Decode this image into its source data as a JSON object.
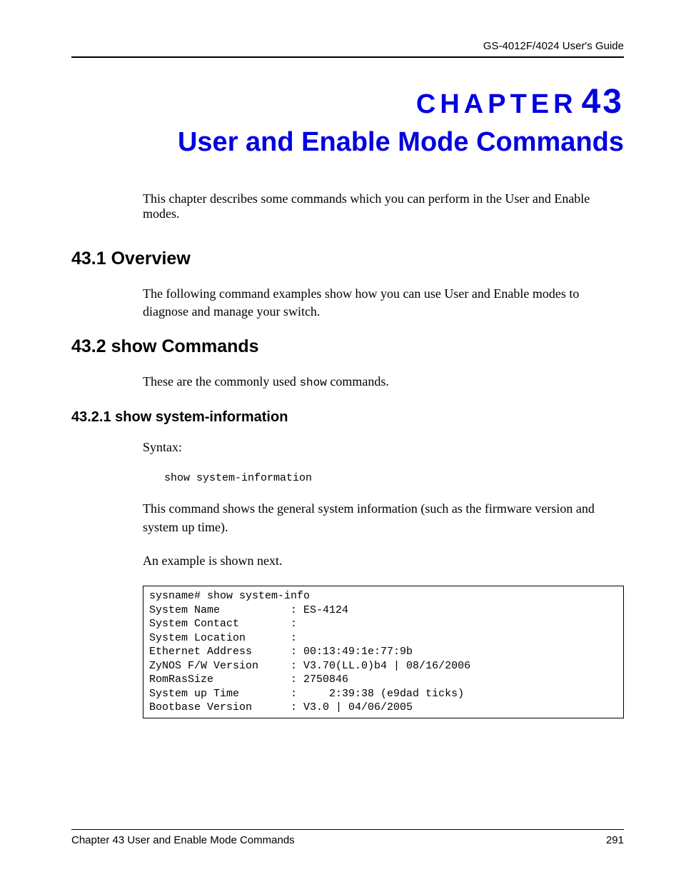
{
  "header": {
    "guide_title": "GS-4012F/4024 User's Guide"
  },
  "chapter": {
    "label_word": "CHAPTER",
    "label_num": "43",
    "title": "User and Enable Mode Commands"
  },
  "intro_text": "This chapter describes some commands which you can perform in the User and Enable modes.",
  "sections": {
    "s1": {
      "heading": "43.1  Overview",
      "body": "The following command examples show how you can use User and Enable modes to diagnose and manage your switch."
    },
    "s2": {
      "heading": "43.2  show Commands",
      "body_pre": "These are the commonly used ",
      "body_mono": "show",
      "body_post": " commands.",
      "sub1": {
        "heading": "43.2.1  show system-information",
        "syntax_label": "Syntax:",
        "syntax_cmd": "show system-information",
        "desc": "This command shows the general system information (such as the firmware version and system up time).",
        "example_intro": "An example is shown next.",
        "code": "sysname# show system-info\nSystem Name           : ES-4124\nSystem Contact        :\nSystem Location       :\nEthernet Address      : 00:13:49:1e:77:9b\nZyNOS F/W Version     : V3.70(LL.0)b4 | 08/16/2006\nRomRasSize            : 2750846\nSystem up Time        :     2:39:38 (e9dad ticks)\nBootbase Version      : V3.0 | 04/06/2005"
      }
    }
  },
  "footer": {
    "left": "Chapter 43  User and Enable Mode Commands",
    "right": "291"
  }
}
